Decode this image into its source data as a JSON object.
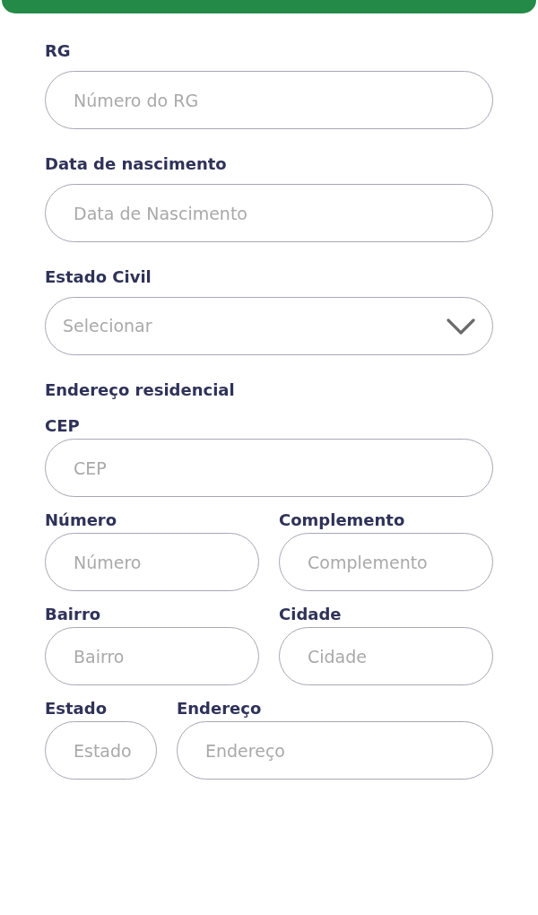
{
  "personal_fields": [
    {
      "kind": "input",
      "label": "RG",
      "placeholder": "Número do RG"
    },
    {
      "kind": "input",
      "label": "Data de nascimento",
      "placeholder": "Data de Nascimento"
    },
    {
      "kind": "select",
      "label": "Estado Civil",
      "placeholder": "Selecionar"
    }
  ],
  "address": {
    "title": "Endereço residencial",
    "rows": [
      [
        {
          "label": "CEP",
          "placeholder": "CEP"
        }
      ],
      [
        {
          "label": "Número",
          "placeholder": "Número"
        },
        {
          "label": "Complemento",
          "placeholder": "Complemento"
        }
      ],
      [
        {
          "label": "Bairro",
          "placeholder": "Bairro"
        },
        {
          "label": "Cidade",
          "placeholder": "Cidade"
        }
      ],
      [
        {
          "label": "Estado",
          "placeholder": "Estado"
        },
        {
          "label": "Endereço",
          "placeholder": "Endereço"
        }
      ]
    ]
  }
}
